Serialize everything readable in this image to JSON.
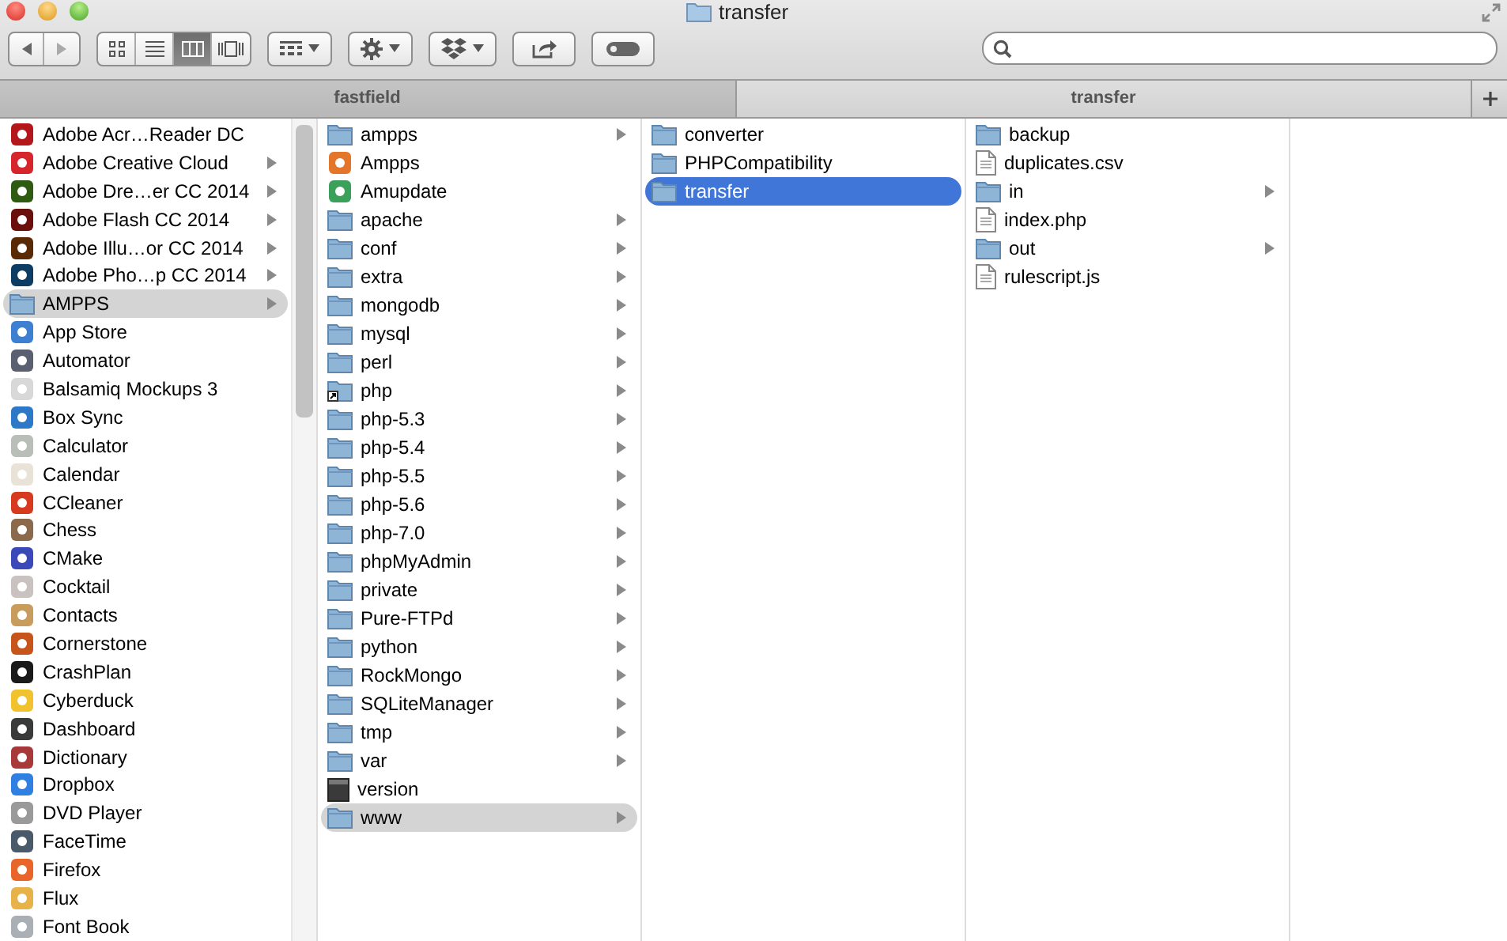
{
  "window": {
    "title": "transfer"
  },
  "toolbar": {
    "view_modes": [
      {
        "kind": "icons",
        "selected": false
      },
      {
        "kind": "list",
        "selected": false
      },
      {
        "kind": "columns",
        "selected": true
      },
      {
        "kind": "coverflow",
        "selected": false
      }
    ]
  },
  "tabs": [
    {
      "label": "fastfield",
      "selected": false
    },
    {
      "label": "transfer",
      "selected": true
    }
  ],
  "columns": [
    {
      "focused": false,
      "scrollbar": true,
      "items": [
        {
          "name": "Adobe Acr…Reader DC",
          "kind": "app",
          "color": "#b3161b",
          "has_children": false,
          "selected": false
        },
        {
          "name": "Adobe Creative Cloud",
          "kind": "app",
          "color": "#d6262b",
          "has_children": true,
          "selected": false
        },
        {
          "name": "Adobe Dre…er CC 2014",
          "kind": "app",
          "color": "#2e5a12",
          "has_children": true,
          "selected": false
        },
        {
          "name": "Adobe Flash CC 2014",
          "kind": "app",
          "color": "#6a0f0b",
          "has_children": true,
          "selected": false
        },
        {
          "name": "Adobe Illu…or CC 2014",
          "kind": "app",
          "color": "#5a2a06",
          "has_children": true,
          "selected": false
        },
        {
          "name": "Adobe Pho…p CC 2014",
          "kind": "app",
          "color": "#0e3c63",
          "has_children": true,
          "selected": false
        },
        {
          "name": "AMPPS",
          "kind": "folder",
          "has_children": true,
          "selected": true
        },
        {
          "name": "App Store",
          "kind": "app",
          "color": "#3d7fd1",
          "has_children": false,
          "selected": false
        },
        {
          "name": "Automator",
          "kind": "app",
          "color": "#5a6070",
          "has_children": false,
          "selected": false
        },
        {
          "name": "Balsamiq Mockups 3",
          "kind": "app",
          "color": "#d8d8d8",
          "has_children": false,
          "selected": false
        },
        {
          "name": "Box Sync",
          "kind": "app",
          "color": "#2d79c7",
          "has_children": false,
          "selected": false
        },
        {
          "name": "Calculator",
          "kind": "app",
          "color": "#b9bfb8",
          "has_children": false,
          "selected": false
        },
        {
          "name": "Calendar",
          "kind": "app",
          "color": "#e9e2d6",
          "has_children": false,
          "selected": false
        },
        {
          "name": "CCleaner",
          "kind": "app",
          "color": "#d63a1f",
          "has_children": false,
          "selected": false
        },
        {
          "name": "Chess",
          "kind": "app",
          "color": "#8a6a4a",
          "has_children": false,
          "selected": false
        },
        {
          "name": "CMake",
          "kind": "app",
          "color": "#3b49b8",
          "has_children": false,
          "selected": false
        },
        {
          "name": "Cocktail",
          "kind": "app",
          "color": "#c9c2c0",
          "has_children": false,
          "selected": false
        },
        {
          "name": "Contacts",
          "kind": "app",
          "color": "#c79c5c",
          "has_children": false,
          "selected": false
        },
        {
          "name": "Cornerstone",
          "kind": "app",
          "color": "#c7541a",
          "has_children": false,
          "selected": false
        },
        {
          "name": "CrashPlan",
          "kind": "app",
          "color": "#1a1a1a",
          "has_children": false,
          "selected": false
        },
        {
          "name": "Cyberduck",
          "kind": "app",
          "color": "#f2c12e",
          "has_children": false,
          "selected": false
        },
        {
          "name": "Dashboard",
          "kind": "app",
          "color": "#3a3a3a",
          "has_children": false,
          "selected": false
        },
        {
          "name": "Dictionary",
          "kind": "app",
          "color": "#a8393a",
          "has_children": false,
          "selected": false
        },
        {
          "name": "Dropbox",
          "kind": "app",
          "color": "#2f80e0",
          "has_children": false,
          "selected": false
        },
        {
          "name": "DVD Player",
          "kind": "app",
          "color": "#9a9a9a",
          "has_children": false,
          "selected": false
        },
        {
          "name": "FaceTime",
          "kind": "app",
          "color": "#4a5a6a",
          "has_children": false,
          "selected": false
        },
        {
          "name": "Firefox",
          "kind": "app",
          "color": "#e8662a",
          "has_children": false,
          "selected": false
        },
        {
          "name": "Flux",
          "kind": "app",
          "color": "#e8b24a",
          "has_children": false,
          "selected": false
        },
        {
          "name": "Font Book",
          "kind": "app",
          "color": "#a9afb5",
          "has_children": false,
          "selected": false
        }
      ]
    },
    {
      "focused": false,
      "items": [
        {
          "name": "ampps",
          "kind": "folder",
          "has_children": true,
          "selected": false
        },
        {
          "name": "Ampps",
          "kind": "app",
          "color": "#e3762b",
          "has_children": false,
          "selected": false
        },
        {
          "name": "Amupdate",
          "kind": "app",
          "color": "#3aa05a",
          "has_children": false,
          "selected": false
        },
        {
          "name": "apache",
          "kind": "folder",
          "has_children": true,
          "selected": false
        },
        {
          "name": "conf",
          "kind": "folder",
          "has_children": true,
          "selected": false
        },
        {
          "name": "extra",
          "kind": "folder",
          "has_children": true,
          "selected": false
        },
        {
          "name": "mongodb",
          "kind": "folder",
          "has_children": true,
          "selected": false
        },
        {
          "name": "mysql",
          "kind": "folder",
          "has_children": true,
          "selected": false
        },
        {
          "name": "perl",
          "kind": "folder",
          "has_children": true,
          "selected": false
        },
        {
          "name": "php",
          "kind": "alias",
          "has_children": true,
          "selected": false
        },
        {
          "name": "php-5.3",
          "kind": "folder",
          "has_children": true,
          "selected": false
        },
        {
          "name": "php-5.4",
          "kind": "folder",
          "has_children": true,
          "selected": false
        },
        {
          "name": "php-5.5",
          "kind": "folder",
          "has_children": true,
          "selected": false
        },
        {
          "name": "php-5.6",
          "kind": "folder",
          "has_children": true,
          "selected": false
        },
        {
          "name": "php-7.0",
          "kind": "folder",
          "has_children": true,
          "selected": false
        },
        {
          "name": "phpMyAdmin",
          "kind": "folder",
          "has_children": true,
          "selected": false
        },
        {
          "name": "private",
          "kind": "folder",
          "has_children": true,
          "selected": false
        },
        {
          "name": "Pure-FTPd",
          "kind": "folder",
          "has_children": true,
          "selected": false
        },
        {
          "name": "python",
          "kind": "folder",
          "has_children": true,
          "selected": false
        },
        {
          "name": "RockMongo",
          "kind": "folder",
          "has_children": true,
          "selected": false
        },
        {
          "name": "SQLiteManager",
          "kind": "folder",
          "has_children": true,
          "selected": false
        },
        {
          "name": "tmp",
          "kind": "folder",
          "has_children": true,
          "selected": false
        },
        {
          "name": "var",
          "kind": "folder",
          "has_children": true,
          "selected": false
        },
        {
          "name": "version",
          "kind": "exec",
          "has_children": false,
          "selected": false
        },
        {
          "name": "www",
          "kind": "folder",
          "has_children": true,
          "selected": true
        }
      ]
    },
    {
      "focused": true,
      "items": [
        {
          "name": "converter",
          "kind": "folder",
          "has_children": false,
          "selected": false
        },
        {
          "name": "PHPCompatibility",
          "kind": "folder",
          "has_children": false,
          "selected": false
        },
        {
          "name": "transfer",
          "kind": "folder",
          "has_children": false,
          "selected": true
        }
      ]
    },
    {
      "items": [
        {
          "name": "backup",
          "kind": "folder",
          "has_children": false,
          "selected": false
        },
        {
          "name": "duplicates.csv",
          "kind": "file",
          "has_children": false,
          "selected": false
        },
        {
          "name": "in",
          "kind": "folder",
          "has_children": true,
          "selected": false
        },
        {
          "name": "index.php",
          "kind": "file",
          "has_children": false,
          "selected": false
        },
        {
          "name": "out",
          "kind": "folder",
          "has_children": true,
          "selected": false
        },
        {
          "name": "rulescript.js",
          "kind": "file",
          "has_children": false,
          "selected": false
        }
      ]
    }
  ]
}
